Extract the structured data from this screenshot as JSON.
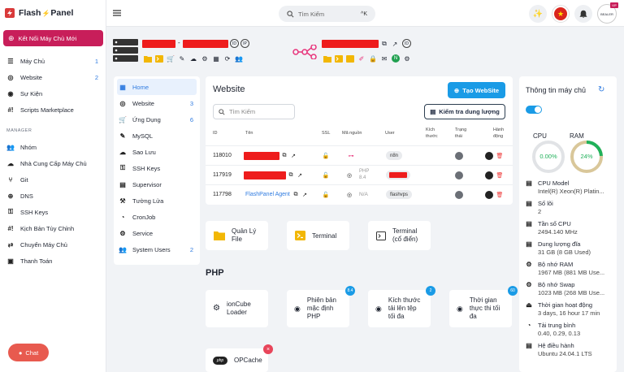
{
  "app": {
    "brand_a": "Flash",
    "brand_b": "Panel"
  },
  "sidebar": {
    "new_button": "Kết Nối Máy Chủ Mới",
    "items": [
      {
        "label": "Máy Chủ",
        "count": "1"
      },
      {
        "label": "Website",
        "count": "2"
      },
      {
        "label": "Sự Kiện",
        "count": ""
      },
      {
        "label": "Scripts Marketplace",
        "count": ""
      }
    ],
    "manager_heading": "MANAGER",
    "manager_items": [
      {
        "label": "Nhóm"
      },
      {
        "label": "Nhà Cung Cấp Máy Chủ"
      },
      {
        "label": "Git"
      },
      {
        "label": "DNS"
      },
      {
        "label": "SSH Keys"
      },
      {
        "label": "Kịch Bản Tùy Chỉnh"
      },
      {
        "label": "Chuyển Máy Chủ"
      },
      {
        "label": "Thanh Toán"
      }
    ],
    "chat_label": "Chat"
  },
  "topbar": {
    "search_placeholder": "Tìm Kiếm",
    "search_shortcut": "^K",
    "avatar_text": "BEALER",
    "avatar_badge": "VIP"
  },
  "server_header": {
    "id_tag": "ID",
    "ip_tag": "IP",
    "separator": "-"
  },
  "submenu": [
    {
      "label": "Home",
      "count": "",
      "active": true
    },
    {
      "label": "Website",
      "count": "3"
    },
    {
      "label": "Ứng Dụng",
      "count": "6"
    },
    {
      "label": "MySQL",
      "count": ""
    },
    {
      "label": "Sao Lưu",
      "count": ""
    },
    {
      "label": "SSH Keys",
      "count": ""
    },
    {
      "label": "Supervisor",
      "count": ""
    },
    {
      "label": "Tường Lửa",
      "count": ""
    },
    {
      "label": "CronJob",
      "count": ""
    },
    {
      "label": "Service",
      "count": ""
    },
    {
      "label": "System Users",
      "count": "2"
    }
  ],
  "website": {
    "title": "Website",
    "create_button": "Tạo WebSite",
    "search_placeholder": "Tìm Kiếm",
    "check_button": "Kiểm tra dung lượng",
    "columns": {
      "id": "ID",
      "name": "Tên",
      "ssl": "SSL",
      "source": "Mã nguồn",
      "user": "User",
      "size_a": "Kích",
      "size_b": "thước",
      "status_a": "Trạng",
      "status_b": "thái",
      "action_a": "Hành",
      "action_b": "động"
    },
    "rows": [
      {
        "id": "118010",
        "name": "",
        "source": "",
        "user": "n8n"
      },
      {
        "id": "117919",
        "name": "",
        "source": "PHP 8.4",
        "user": ""
      },
      {
        "id": "117798",
        "name": "FlashPanel Agent",
        "source": "N/A",
        "user": "flashvps"
      }
    ]
  },
  "quick": [
    {
      "label_a": "Quản Lý",
      "label_b": "File"
    },
    {
      "label_a": "Terminal",
      "label_b": ""
    },
    {
      "label_a": "Terminal",
      "label_b": "(cổ điển)"
    }
  ],
  "php": {
    "heading": "PHP",
    "cards": [
      {
        "l1": "ionCube",
        "l2": "Loader",
        "l3": "",
        "badge": ""
      },
      {
        "l1": "Phiên bản",
        "l2": "mặc định",
        "l3": "PHP",
        "badge": "8.4"
      },
      {
        "l1": "Kích thước",
        "l2": "tải lên tệp",
        "l3": "tối đa",
        "badge": "2"
      },
      {
        "l1": "Thời gian",
        "l2": "thực thi tối",
        "l3": "đa",
        "badge": "60"
      },
      {
        "l1": "OPCache",
        "l2": "",
        "l3": "",
        "badge": "×"
      }
    ]
  },
  "server_info": {
    "title": "Thông tin máy chủ",
    "cpu_label": "CPU",
    "cpu_value": "0.00%",
    "cpu_fraction": 0.0,
    "ram_label": "RAM",
    "ram_value": "24%",
    "ram_fraction": 0.24,
    "rows": [
      {
        "k": "CPU Model",
        "v": "Intel(R) Xeon(R) Platin..."
      },
      {
        "k": "Số lõi",
        "v": "2"
      },
      {
        "k": "Tần số CPU",
        "v": "2494.140 MHz"
      },
      {
        "k": "Dung lượng đĩa",
        "v": "31 GB (8 GB Used)"
      },
      {
        "k": "Bộ nhớ RAM",
        "v": "1967 MB (881 MB Use..."
      },
      {
        "k": "Bộ nhớ Swap",
        "v": "1023 MB (268 MB Use..."
      },
      {
        "k": "Thời gian hoạt động",
        "v": "3 days, 16 hour 17 min"
      },
      {
        "k": "Tải trung bình",
        "v": "0.40, 0.29, 0.13"
      },
      {
        "k": "Hệ điều hành",
        "v": "Ubuntu 24.04.1 LTS"
      }
    ]
  },
  "colors": {
    "accent": "#1a9be6",
    "brand": "#c81e5a",
    "danger": "#ee1c1c",
    "ok": "#20b15a"
  }
}
